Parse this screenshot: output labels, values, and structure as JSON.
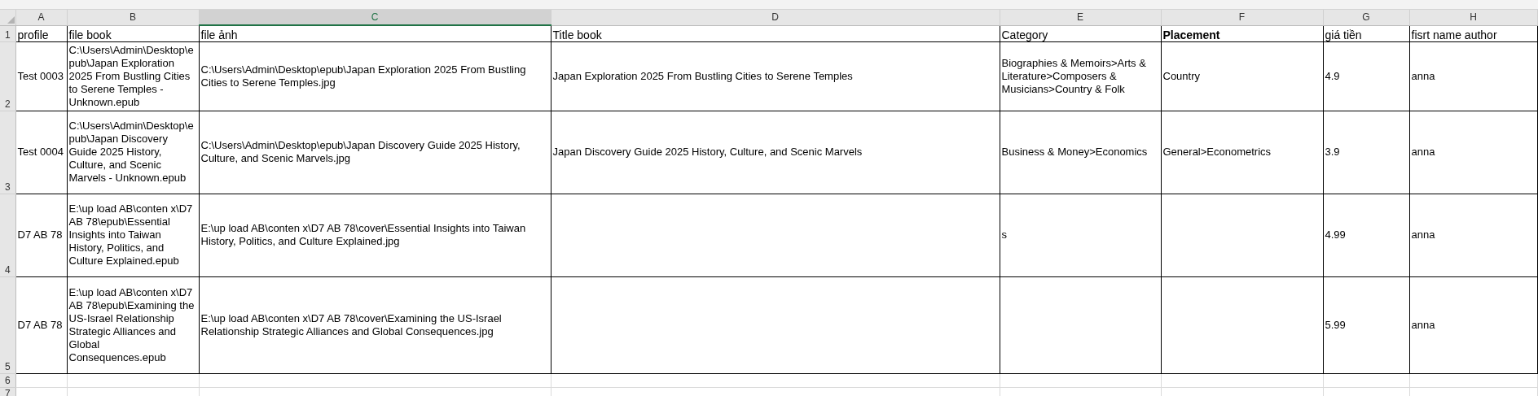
{
  "columns": [
    {
      "letter": "A",
      "selected": false
    },
    {
      "letter": "B",
      "selected": false
    },
    {
      "letter": "C",
      "selected": true
    },
    {
      "letter": "D",
      "selected": false
    },
    {
      "letter": "E",
      "selected": false
    },
    {
      "letter": "F",
      "selected": false
    },
    {
      "letter": "G",
      "selected": false
    },
    {
      "letter": "H",
      "selected": false
    }
  ],
  "rows": [
    {
      "number": "1",
      "kind": "header",
      "cells": [
        {
          "text": "profile",
          "bold": false
        },
        {
          "text": "file book",
          "bold": false
        },
        {
          "text": "file ảnh",
          "bold": false
        },
        {
          "text": "Title book",
          "bold": false
        },
        {
          "text": "Category",
          "bold": false
        },
        {
          "text": "Placement",
          "bold": true
        },
        {
          "text": "giá tiền",
          "bold": false
        },
        {
          "text": "fisrt name author",
          "bold": false
        }
      ]
    },
    {
      "number": "2",
      "kind": "data",
      "cells": [
        "Test 0003",
        "C:\\Users\\Admin\\Desktop\\epub\\Japan Exploration 2025 From Bustling Cities to Serene Temples - Unknown.epub",
        "C:\\Users\\Admin\\Desktop\\epub\\Japan Exploration 2025 From Bustling Cities to Serene Temples.jpg",
        "Japan Exploration 2025 From Bustling Cities to Serene Temples",
        "Biographies & Memoirs>Arts & Literature>Composers & Musicians>Country & Folk",
        "Country",
        "4.9",
        "anna"
      ]
    },
    {
      "number": "3",
      "kind": "data",
      "cells": [
        "Test 0004",
        "C:\\Users\\Admin\\Desktop\\epub\\Japan Discovery Guide 2025 History, Culture, and Scenic Marvels - Unknown.epub",
        "C:\\Users\\Admin\\Desktop\\epub\\Japan Discovery Guide 2025 History, Culture, and Scenic Marvels.jpg",
        "Japan Discovery Guide 2025 History, Culture, and Scenic Marvels",
        "Business & Money>Economics",
        "General>Econometrics",
        "3.9",
        "anna"
      ]
    },
    {
      "number": "4",
      "kind": "data",
      "cells": [
        "D7 AB 78",
        "E:\\up load AB\\conten x\\D7 AB 78\\epub\\Essential Insights into Taiwan History, Politics, and Culture Explained.epub",
        "E:\\up load AB\\conten x\\D7 AB 78\\cover\\Essential Insights into Taiwan History, Politics, and Culture Explained.jpg",
        null,
        "s",
        null,
        "4.99",
        "anna"
      ]
    },
    {
      "number": "5",
      "kind": "data",
      "cells": [
        "D7 AB 78",
        "E:\\up load AB\\conten x\\D7 AB 78\\epub\\Examining the US-Israel Relationship Strategic Alliances and Global Consequences.epub",
        "E:\\up load AB\\conten x\\D7 AB 78\\cover\\Examining the US-Israel Relationship Strategic Alliances and Global Consequences.jpg",
        null,
        null,
        null,
        "5.99",
        "anna"
      ]
    },
    {
      "number": "6",
      "kind": "empty",
      "cells": []
    },
    {
      "number": "7",
      "kind": "empty",
      "cells": []
    }
  ]
}
